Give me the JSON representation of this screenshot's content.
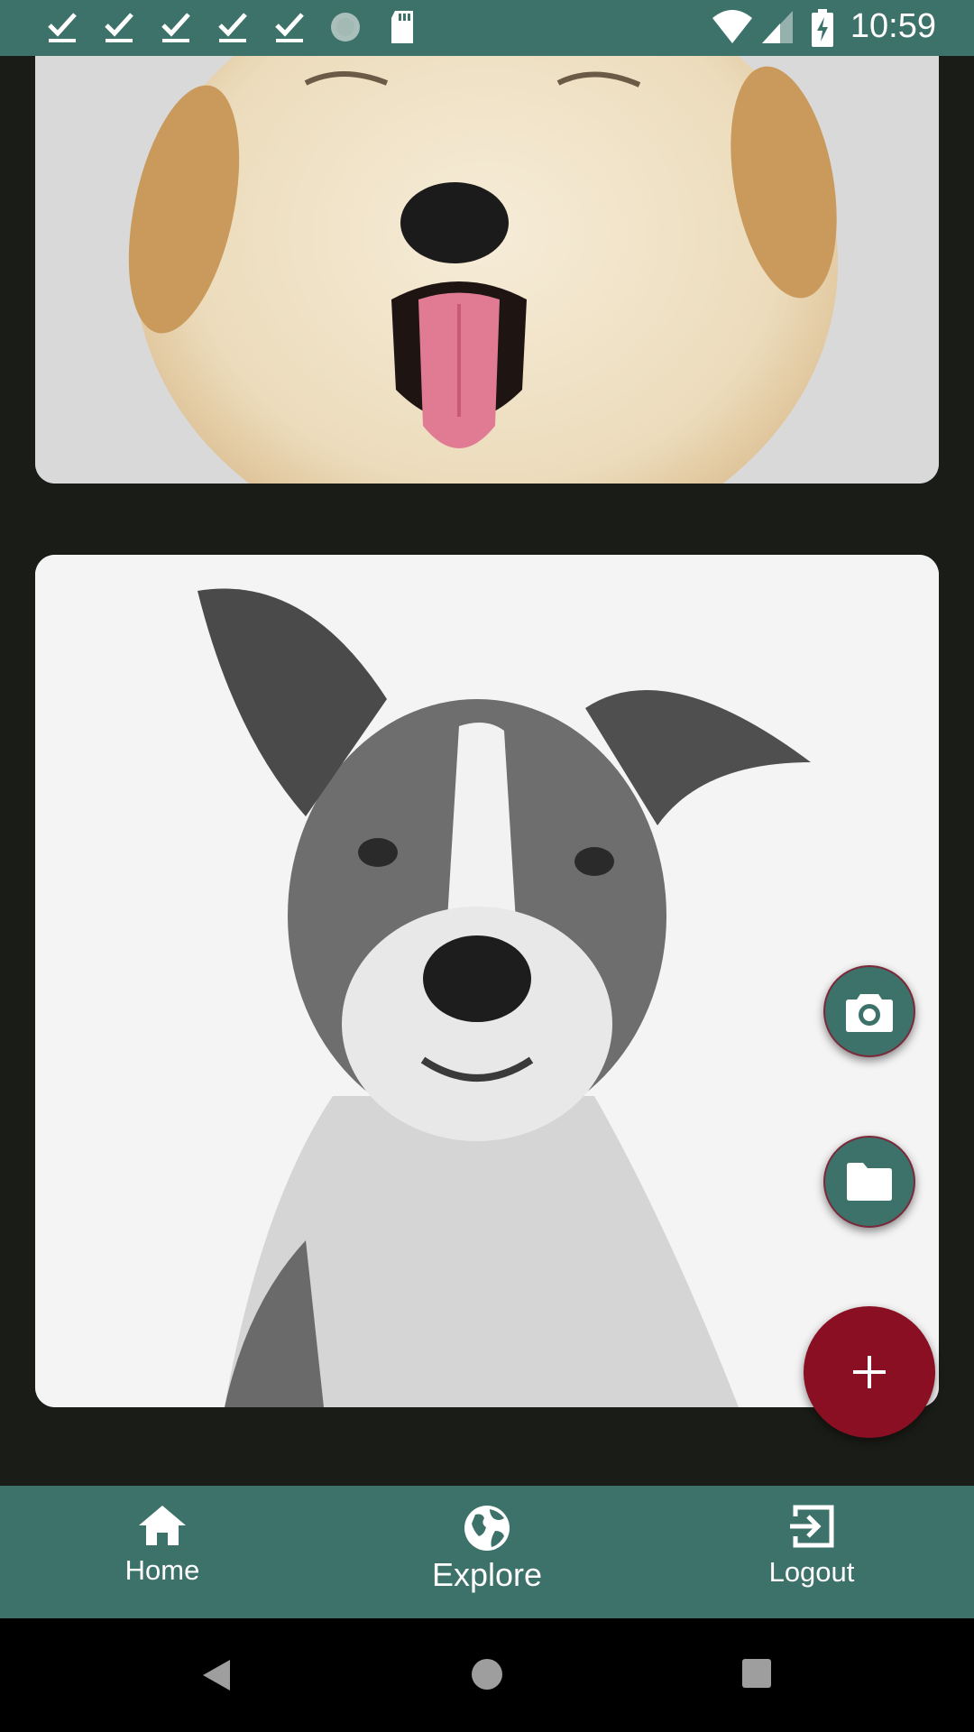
{
  "status_bar": {
    "time": "10:59",
    "left_icons": [
      "check-icon",
      "check-icon",
      "check-icon",
      "check-icon",
      "check-icon",
      "loading-icon",
      "sd-card-icon"
    ],
    "right_icons": [
      "wifi-icon",
      "signal-icon",
      "battery-charging-icon"
    ]
  },
  "feed": {
    "posts": [
      {
        "image": "golden-puppy-photo"
      },
      {
        "image": "gray-dog-photo"
      }
    ]
  },
  "fabs": {
    "camera_icon": "camera-icon",
    "folder_icon": "folder-icon",
    "add_icon": "plus-icon"
  },
  "bottom_nav": {
    "items": [
      {
        "label": "Home",
        "icon": "home-icon"
      },
      {
        "label": "Explore",
        "icon": "globe-icon"
      },
      {
        "label": "Logout",
        "icon": "logout-icon"
      }
    ]
  },
  "colors": {
    "primary": "#3d726a",
    "accent": "#8b0f23",
    "background": "#1a1c17"
  }
}
